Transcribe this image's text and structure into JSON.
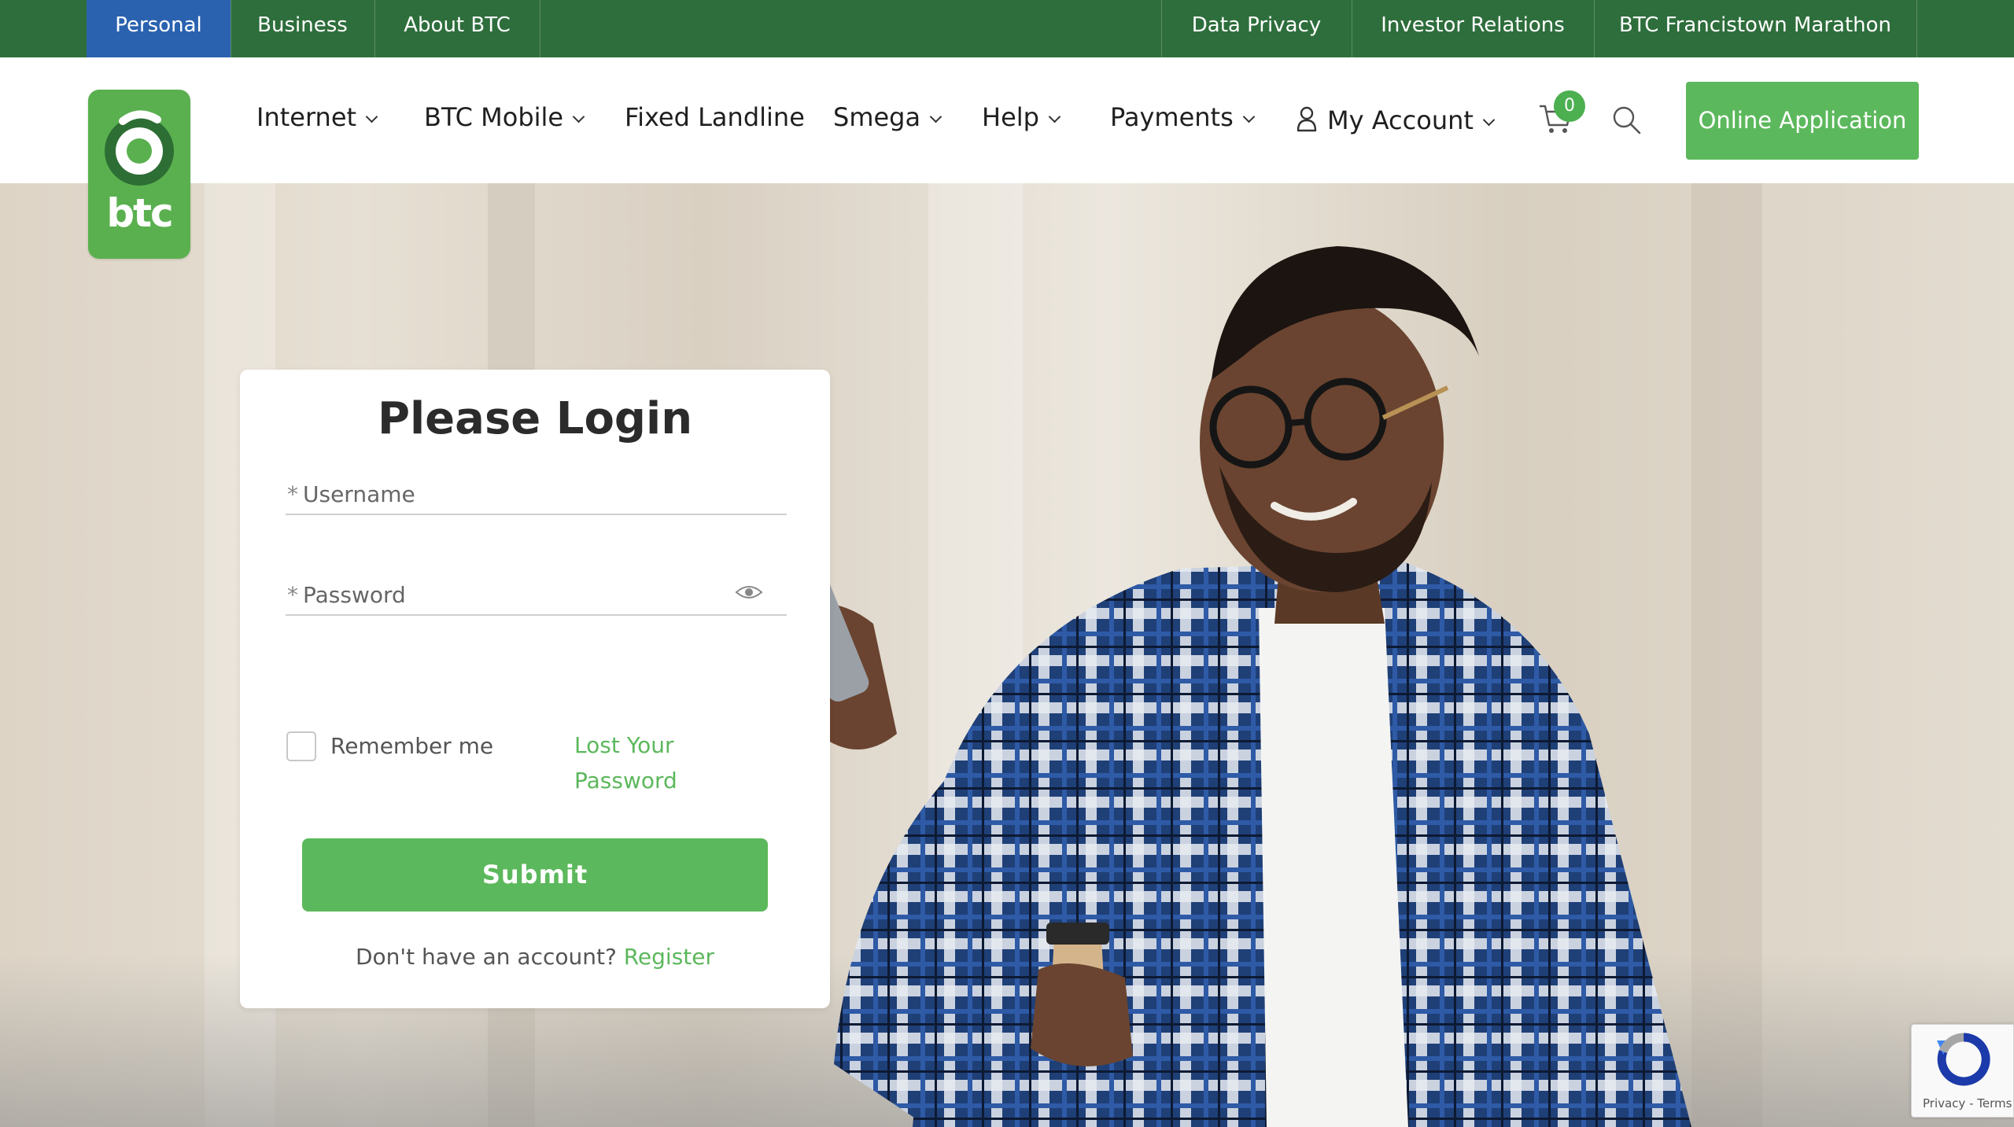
{
  "topbar": {
    "left_tabs": [
      "Personal",
      "Business",
      "About BTC"
    ],
    "active_tab": "Personal",
    "right_links": [
      "Data Privacy",
      "Investor Relations",
      "BTC Francistown Marathon"
    ]
  },
  "header": {
    "logo_text": "btc",
    "nav": {
      "internet": "Internet",
      "btc_mobile": "BTC Mobile",
      "fixed_landline": "Fixed Landline",
      "smega": "Smega",
      "help": "Help",
      "payments": "Payments",
      "my_account": "My Account"
    },
    "cart_count": "0",
    "online_application": "Online Application"
  },
  "login": {
    "title": "Please Login",
    "required_mark": "*",
    "username_placeholder": "Username",
    "password_placeholder": "Password",
    "remember_me": "Remember me",
    "lost_password": "Lost Your Password",
    "submit": "Submit",
    "no_account": "Don't have an account?",
    "register": "Register"
  },
  "recaptcha": {
    "privacy": "Privacy",
    "separator": "-",
    "terms": "Terms"
  },
  "colors": {
    "topbar_green": "#2e6e3c",
    "active_blue": "#2a62b0",
    "brand_green": "#5cb85c"
  },
  "icons": [
    "user-icon",
    "cart-icon",
    "search-icon",
    "eye-icon",
    "recaptcha-icon",
    "chevron-down-icon"
  ]
}
